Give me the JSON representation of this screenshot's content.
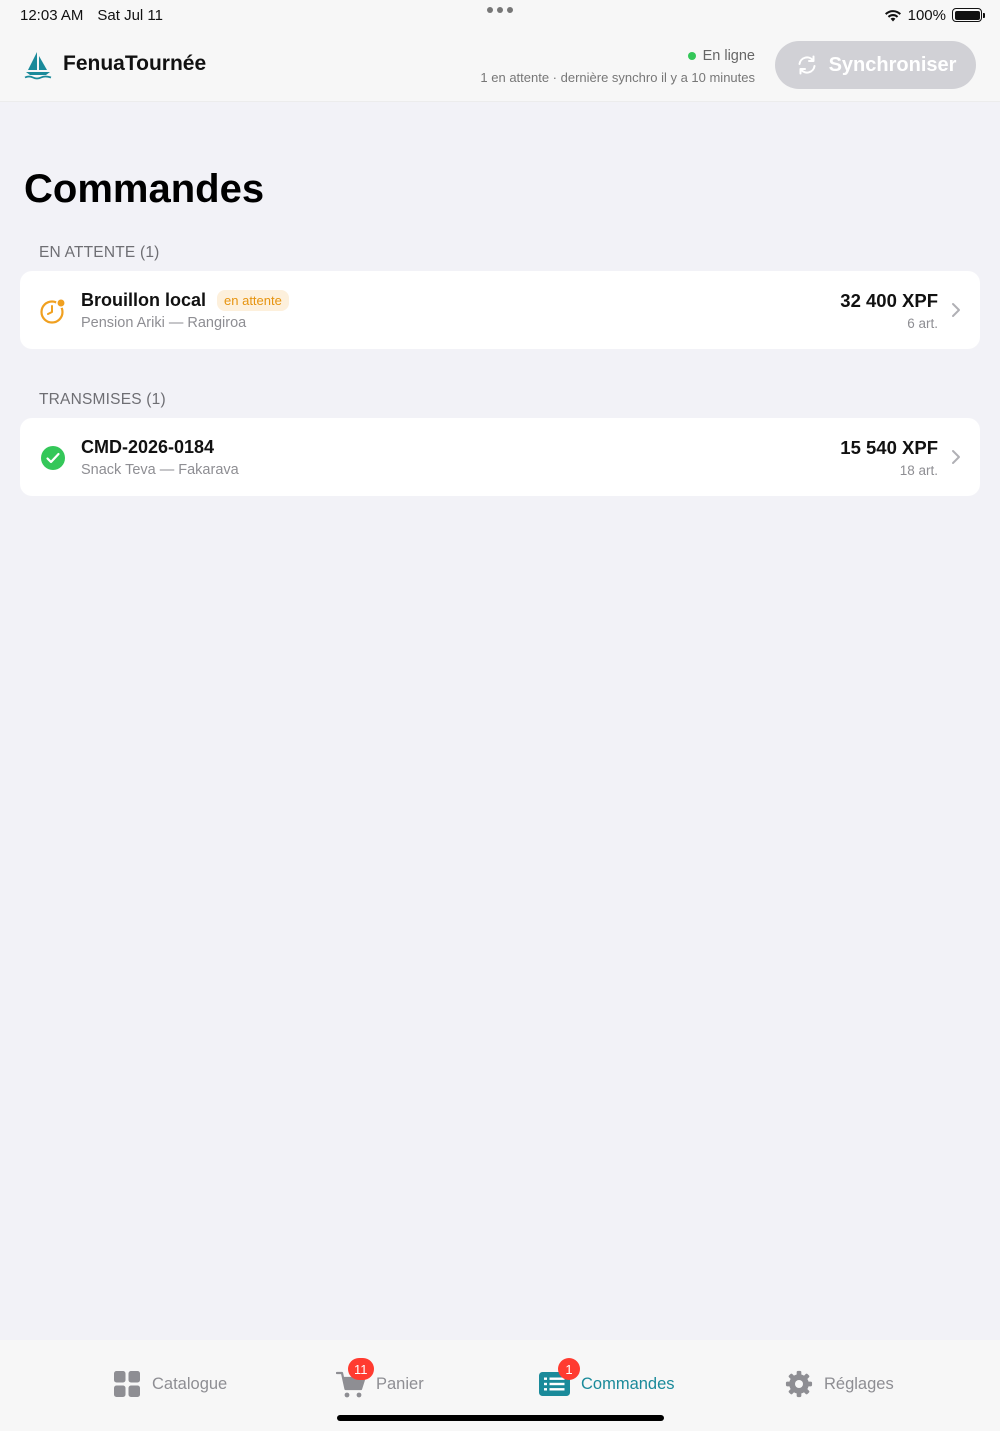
{
  "status_bar": {
    "time": "12:03 AM",
    "date": "Sat Jul 11",
    "battery": "100%"
  },
  "header": {
    "app_name": "FenuaTournée",
    "connection_status": "En ligne",
    "sync_info": "1 en attente · dernière synchro il y a 10 minutes",
    "sync_button_label": "Synchroniser"
  },
  "page": {
    "title": "Commandes"
  },
  "sections": [
    {
      "header": "EN ATTENTE (1)",
      "orders": [
        {
          "title": "Brouillon local",
          "badge": "en attente",
          "customer": "Pension Ariki — Rangiroa",
          "amount": "32 400 XPF",
          "items": "6 art.",
          "status": "pending"
        }
      ]
    },
    {
      "header": "TRANSMISES (1)",
      "orders": [
        {
          "title": "CMD-2026-0184",
          "badge": "",
          "customer": "Snack Teva — Fakarava",
          "amount": "15 540 XPF",
          "items": "18 art.",
          "status": "sent"
        }
      ]
    }
  ],
  "tabbar": {
    "tabs": [
      {
        "label": "Catalogue",
        "icon": "grid-icon",
        "badge": ""
      },
      {
        "label": "Panier",
        "icon": "cart-icon",
        "badge": "11"
      },
      {
        "label": "Commandes",
        "icon": "list-icon",
        "badge": "1",
        "active": true
      },
      {
        "label": "Réglages",
        "icon": "gear-icon",
        "badge": ""
      }
    ]
  },
  "colors": {
    "accent": "#1a8a9a",
    "online": "#34c759",
    "pending": "#f0a020",
    "success": "#34c759",
    "badge": "#ff3b30",
    "background": "#f2f2f7"
  }
}
